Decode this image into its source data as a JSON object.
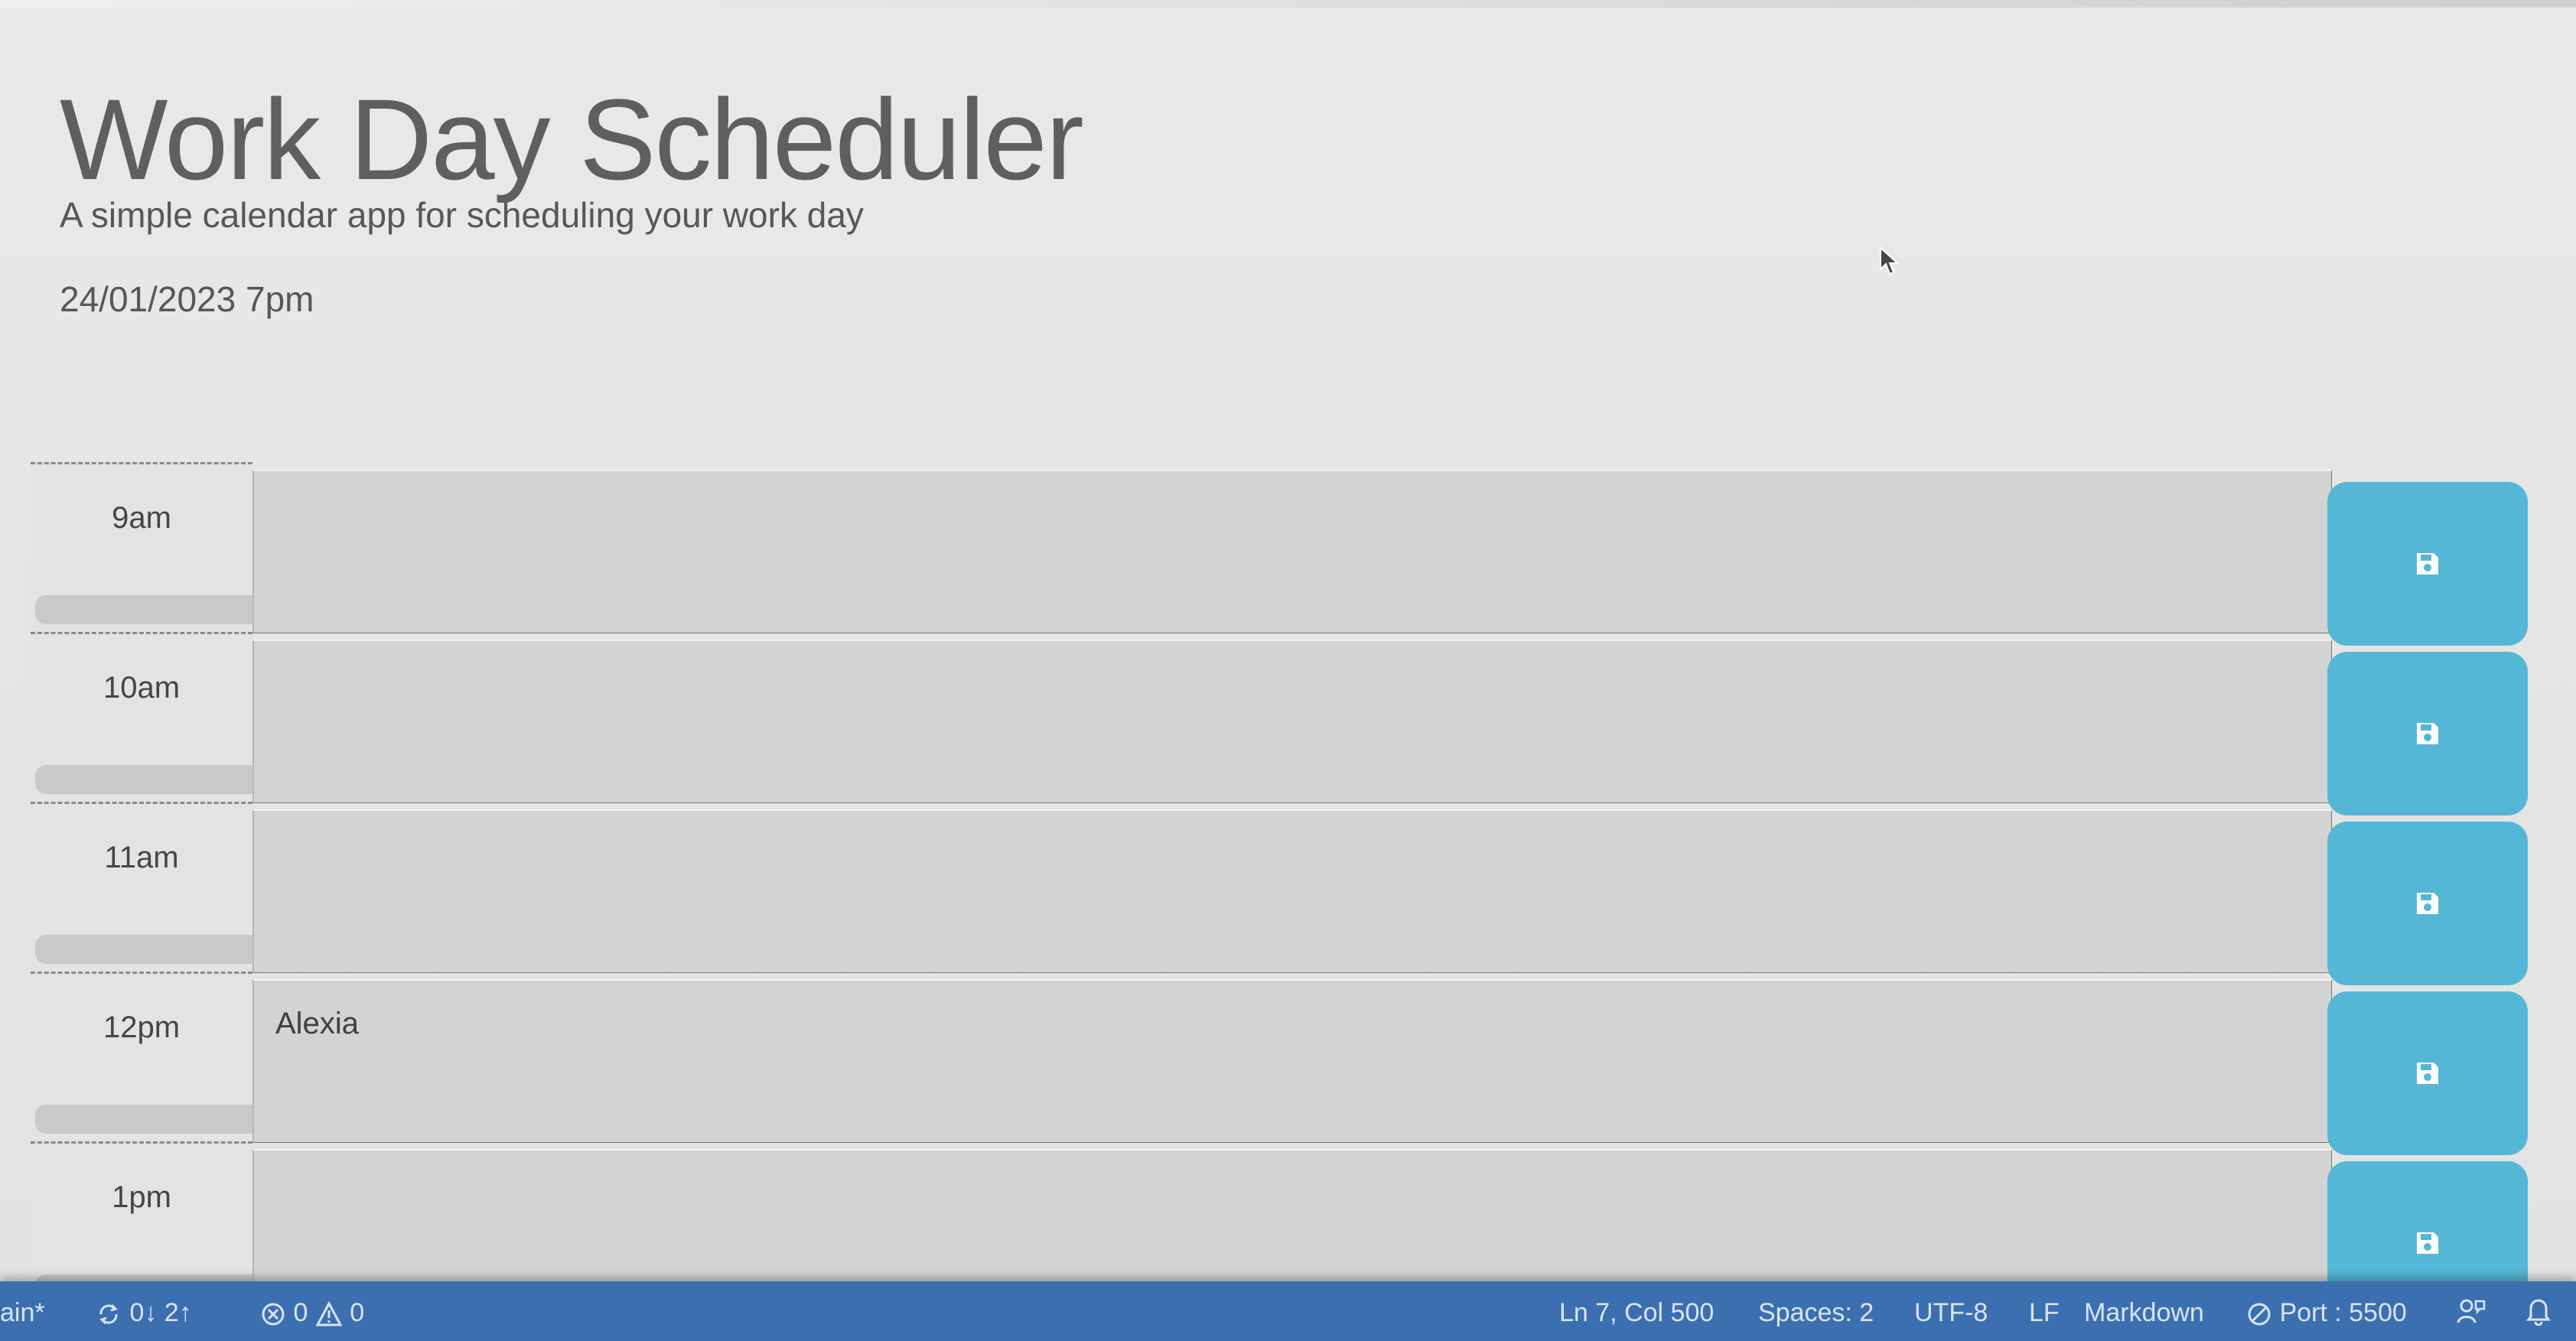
{
  "header": {
    "title": "Work Day Scheduler",
    "lead": "A simple calendar app for scheduling your work day",
    "current_day": "24/01/2023 7pm"
  },
  "time_blocks": [
    {
      "hour": "9am",
      "description": ""
    },
    {
      "hour": "10am",
      "description": ""
    },
    {
      "hour": "11am",
      "description": ""
    },
    {
      "hour": "12pm",
      "description": "Alexia"
    },
    {
      "hour": "1pm",
      "description": ""
    }
  ],
  "colors": {
    "past_block": "#d3d3d3",
    "save_button": "#55b7d6",
    "status_bar": "#3c6fb0"
  },
  "icons": {
    "save": "save-floppy-icon",
    "sync": "sync-icon",
    "errors": "error-circle-icon",
    "warnings": "warning-icon",
    "port": "port-broadcast-icon",
    "feedback": "feedback-icon",
    "bell": "bell-icon"
  },
  "status_bar": {
    "branch": "ain*",
    "sync": "0↓ 2↑",
    "errors": "0",
    "warnings": "0",
    "cursor_position": "Ln 7, Col 500",
    "spaces": "Spaces: 2",
    "encoding": "UTF-8",
    "line_ending": "LF",
    "language": "Markdown",
    "port": "Port : 5500"
  }
}
